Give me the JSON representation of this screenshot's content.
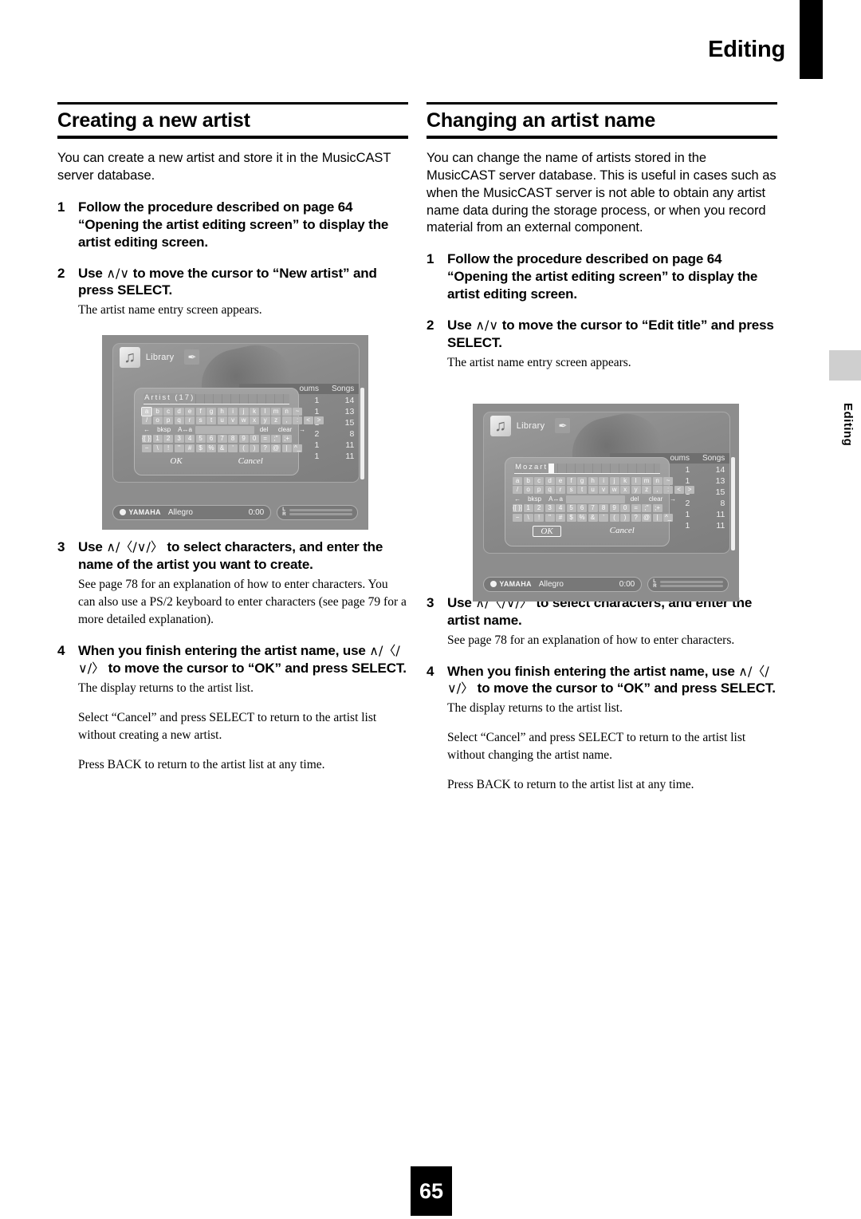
{
  "page": {
    "running_head": "Editing",
    "side_tab_label": "Editing",
    "page_number": "65"
  },
  "left_column": {
    "title": "Creating a new artist",
    "intro": "You can create a new artist and store it in the MusicCAST server database.",
    "steps": [
      {
        "num": "1",
        "head": "Follow the procedure described on page 64 “Opening the artist editing screen” to display the artist editing screen."
      },
      {
        "num": "2",
        "head_pre": "Use ",
        "arrows": "∧/∨",
        "head_post": " to move the cursor to “New artist” and press SELECT.",
        "sub": "The artist name entry screen appears."
      },
      {
        "num": "3",
        "head_pre": "Use ",
        "arrows": "∧/〈/∨/〉",
        "head_post": " to select characters, and enter the name of the artist you want to create.",
        "sub": "See page 78 for an explanation of how to enter characters. You can also use a PS/2 keyboard to enter characters (see page 79 for a more detailed explanation)."
      },
      {
        "num": "4",
        "head_pre": "When you finish entering the artist name, use ",
        "arrows": "∧/〈/∨/〉",
        "head_post": " to move the cursor to “OK” and press SELECT.",
        "sub": "The display returns to the artist list.",
        "sub2": "Select “Cancel” and press SELECT to return to the artist list without creating a new artist.",
        "sub3": "Press BACK to return to the artist list at any time."
      }
    ]
  },
  "right_column": {
    "title": "Changing an artist name",
    "intro": "You can change the name of artists stored in the MusicCAST server database. This is useful in cases such as when the MusicCAST server is not able to obtain any artist name data during the storage process, or when you record material from an external component.",
    "steps": [
      {
        "num": "1",
        "head": "Follow the procedure described on page 64 “Opening the artist editing screen” to display the artist editing screen."
      },
      {
        "num": "2",
        "head_pre": "Use ",
        "arrows": "∧/∨",
        "head_post": " to move the cursor to “Edit title” and press SELECT.",
        "sub": "The artist name entry screen appears."
      },
      {
        "num": "3",
        "head_pre": "Use ",
        "arrows": "∧/〈/∨/〉",
        "head_post": " to select characters, and enter the artist name.",
        "sub": "See page 78 for an explanation of how to enter characters."
      },
      {
        "num": "4",
        "head_pre": "When you finish entering the artist name, use ",
        "arrows": "∧/〈/∨/〉",
        "head_post": " to move the cursor to “OK” and press SELECT.",
        "sub": "The display returns to the artist list.",
        "sub2": "Select “Cancel” and press SELECT to return to the artist list without changing the artist name.",
        "sub3": "Press BACK to return to the artist list at any time."
      }
    ]
  },
  "screenshot_one": {
    "library_label": "Library",
    "entry_text": "Artist (17)",
    "list_headers": [
      "oums",
      "Songs"
    ],
    "list_rows": [
      [
        "1",
        "14"
      ],
      [
        "1",
        "13"
      ],
      [
        "1",
        "15"
      ],
      [
        "2",
        "8"
      ],
      [
        "1",
        "11"
      ],
      [
        "1",
        "11"
      ]
    ],
    "keyboard_rows": [
      [
        "a",
        "b",
        "c",
        "d",
        "e",
        "f",
        "g",
        "h",
        "i",
        "j",
        "k",
        "l",
        "m",
        "n",
        "~"
      ],
      [
        "/",
        "o",
        "p",
        "q",
        "r",
        "s",
        "t",
        "u",
        "v",
        "w",
        "x",
        "y",
        "z",
        ",",
        ":",
        "<",
        ">"
      ],
      [
        "←",
        "bksp",
        "A↔a",
        "",
        "del",
        "clear",
        "→"
      ],
      [
        "{[ }]",
        "1",
        "2",
        "3",
        "4",
        "5",
        "6",
        "7",
        "8",
        "9",
        "0",
        "=",
        ";\"",
        ";+"
      ],
      [
        "−",
        "\\",
        "!",
        "\"",
        "#",
        "$",
        "%",
        "&",
        "'",
        "(",
        ")",
        "?",
        "@",
        "|",
        "^_"
      ]
    ],
    "selected_key": "a",
    "ok_label": "OK",
    "cancel_label": "Cancel",
    "ok_highlighted": false,
    "brand": "YAMAHA",
    "track": "Allegro",
    "time": "0:00",
    "meter_left": "L",
    "meter_right": "R"
  },
  "screenshot_two": {
    "library_label": "Library",
    "entry_text": "Mozart",
    "list_headers": [
      "oums",
      "Songs"
    ],
    "list_rows": [
      [
        "1",
        "14"
      ],
      [
        "1",
        "13"
      ],
      [
        "1",
        "15"
      ],
      [
        "2",
        "8"
      ],
      [
        "1",
        "11"
      ],
      [
        "1",
        "11"
      ]
    ],
    "keyboard_rows": [
      [
        "a",
        "b",
        "c",
        "d",
        "e",
        "f",
        "g",
        "h",
        "i",
        "j",
        "k",
        "l",
        "m",
        "n",
        "~"
      ],
      [
        "/",
        "o",
        "p",
        "q",
        "r",
        "s",
        "t",
        "u",
        "v",
        "w",
        "x",
        "y",
        "z",
        ",",
        ":",
        "<",
        ">"
      ],
      [
        "←",
        "bksp",
        "A↔a",
        "",
        "del",
        "clear",
        "→"
      ],
      [
        "{[ }]",
        "1",
        "2",
        "3",
        "4",
        "5",
        "6",
        "7",
        "8",
        "9",
        "0",
        "=",
        ";\"",
        ";+"
      ],
      [
        "−",
        "\\",
        "!",
        "\"",
        "#",
        "$",
        "%",
        "&",
        "'",
        "(",
        ")",
        "?",
        "@",
        "|",
        "^_"
      ]
    ],
    "selected_key": "",
    "ok_label": "OK",
    "cancel_label": "Cancel",
    "ok_highlighted": true,
    "brand": "YAMAHA",
    "track": "Allegro",
    "time": "0:00",
    "meter_left": "L",
    "meter_right": "R"
  }
}
